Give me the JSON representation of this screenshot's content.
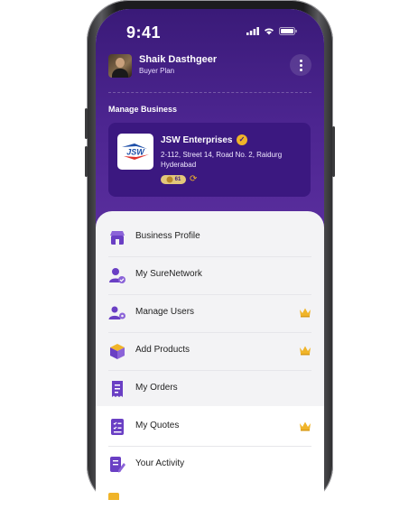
{
  "status_bar": {
    "time": "9:41"
  },
  "user": {
    "name": "Shaik Dasthgeer",
    "plan": "Buyer Plan"
  },
  "manage_business": {
    "title": "Manage Business",
    "business": {
      "name": "JSW Enterprises",
      "logo_text": "JSW",
      "address": "2-112, Street 14, Road No. 2, Raidurg Hyderabad",
      "coin_badge": "61"
    }
  },
  "menu": [
    {
      "label": "Business Profile",
      "icon": "store-icon",
      "premium": false
    },
    {
      "label": "My SureNetwork",
      "icon": "user-check-icon",
      "premium": false
    },
    {
      "label": "Manage Users",
      "icon": "users-gear-icon",
      "premium": true
    },
    {
      "label": "Add Products",
      "icon": "box-icon",
      "premium": true
    },
    {
      "label": "My Orders",
      "icon": "receipt-icon",
      "premium": false
    },
    {
      "label": "My Quotes",
      "icon": "checklist-icon",
      "premium": true
    },
    {
      "label": "Your Activity",
      "icon": "edit-document-icon",
      "premium": false
    }
  ],
  "colors": {
    "primary": "#4c2590",
    "accent": "#f0b429",
    "icon": "#6a3fc4"
  }
}
